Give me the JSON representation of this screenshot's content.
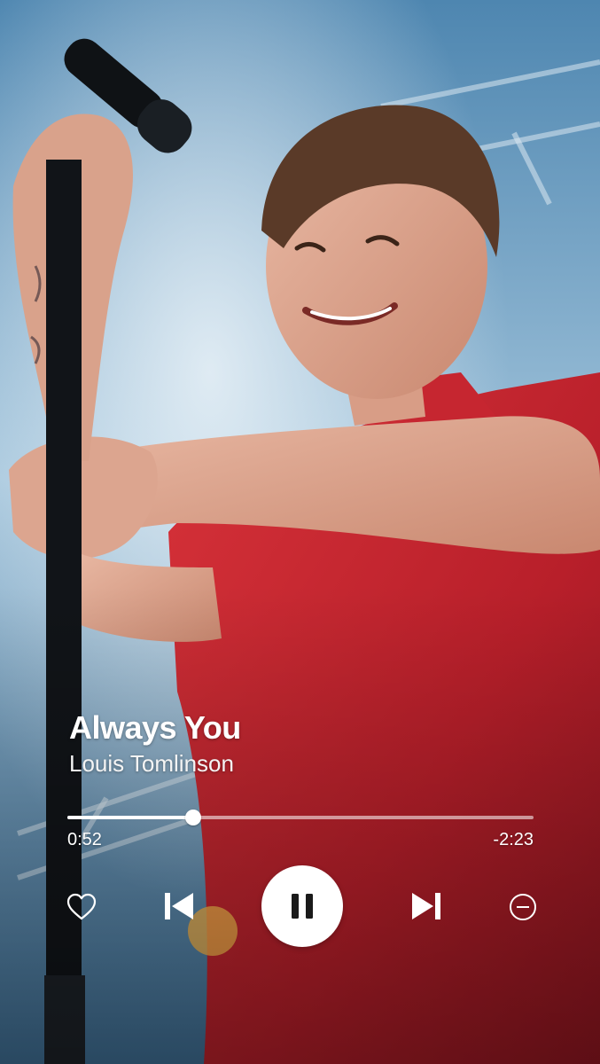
{
  "track": {
    "title": "Always You",
    "artist": "Louis Tomlinson"
  },
  "playback": {
    "elapsed": "0:52",
    "remaining": "-2:23",
    "progress": 0.27,
    "state": "playing"
  },
  "controls": {
    "like_icon": "heart-outline-icon",
    "previous_icon": "skip-previous-icon",
    "play_pause_icon": "pause-icon",
    "next_icon": "skip-next-icon",
    "hide_icon": "minus-circle-icon"
  },
  "colors": {
    "text": "#ffffff",
    "control_bg": "#ffffff",
    "control_fg": "#1a1a1a",
    "track_empty": "rgba(255,255,255,0.55)"
  }
}
